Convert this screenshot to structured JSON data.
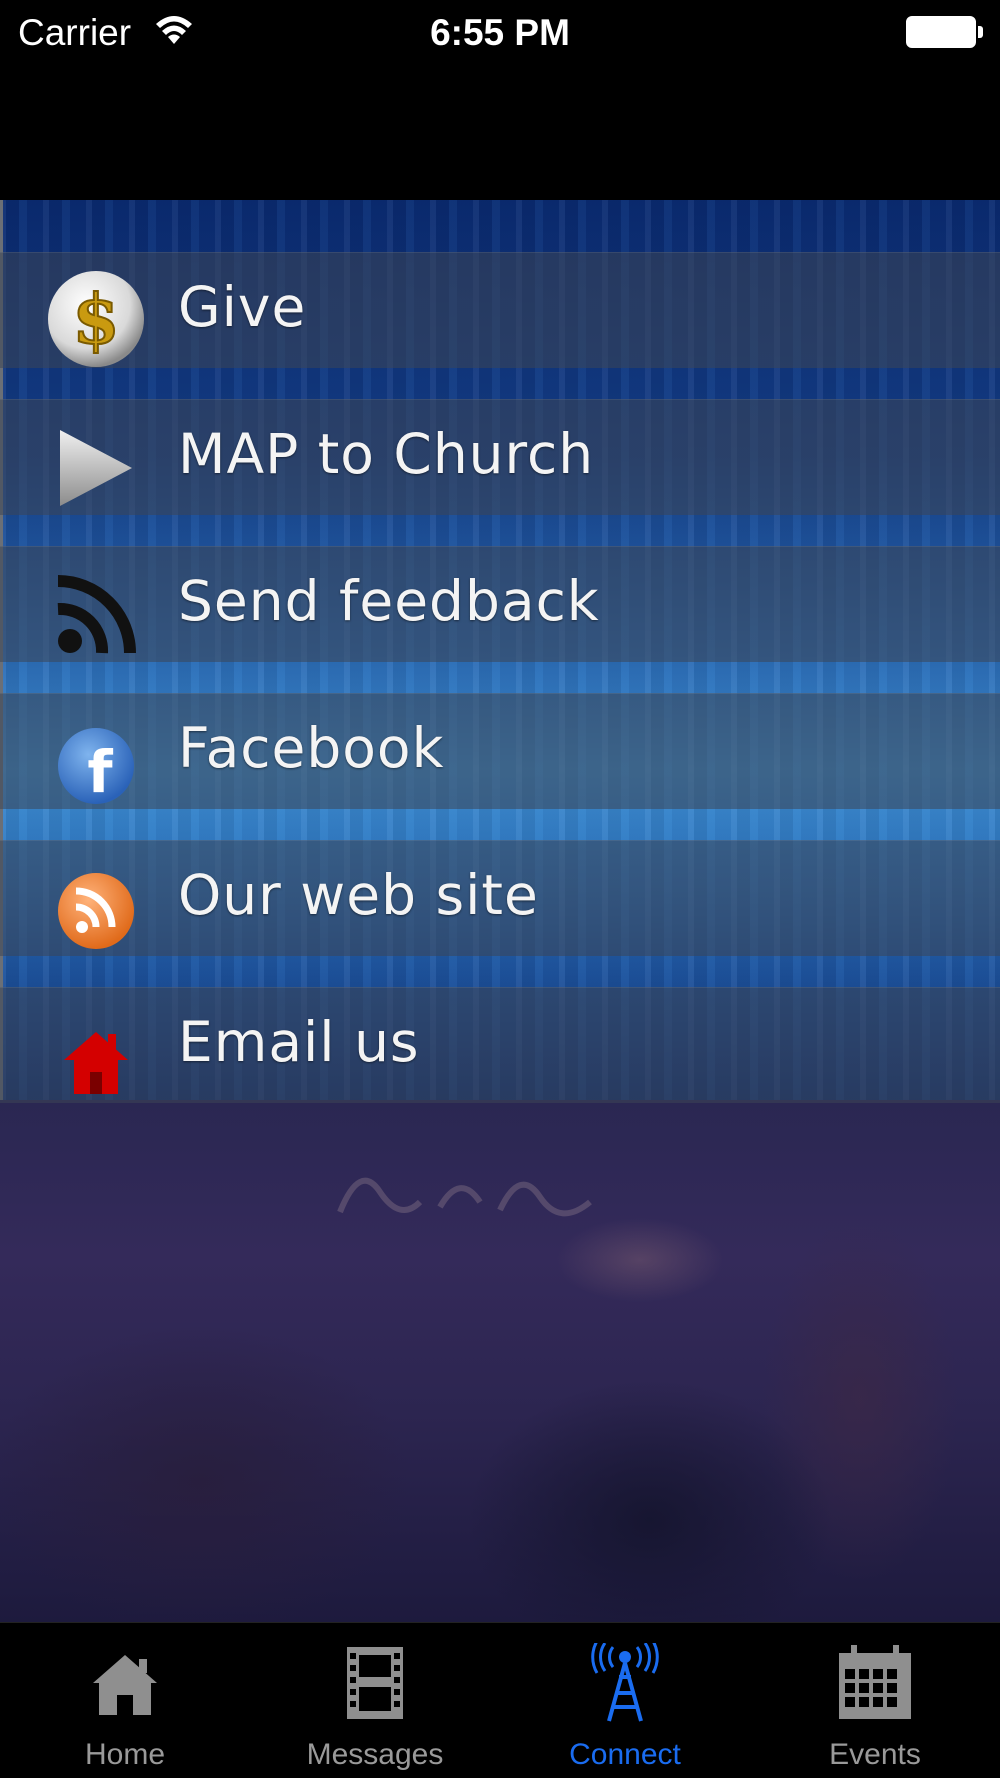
{
  "status_bar": {
    "carrier": "Carrier",
    "time": "6:55 PM"
  },
  "menu": {
    "items": [
      {
        "label": "Give",
        "icon": "dollar-coin-icon"
      },
      {
        "label": "MAP to Church",
        "icon": "play-arrow-icon"
      },
      {
        "label": "Send feedback",
        "icon": "feed-icon"
      },
      {
        "label": "Facebook",
        "icon": "facebook-icon"
      },
      {
        "label": "Our web site",
        "icon": "rss-icon"
      },
      {
        "label": "Email us",
        "icon": "red-house-icon"
      }
    ]
  },
  "tab_bar": {
    "tabs": [
      {
        "label": "Home",
        "icon": "home-icon",
        "active": false
      },
      {
        "label": "Messages",
        "icon": "film-strip-icon",
        "active": false
      },
      {
        "label": "Connect",
        "icon": "radio-tower-icon",
        "active": true
      },
      {
        "label": "Events",
        "icon": "calendar-icon",
        "active": false
      }
    ],
    "active_color": "#1a6cf0",
    "inactive_color": "#9a9a9a"
  }
}
